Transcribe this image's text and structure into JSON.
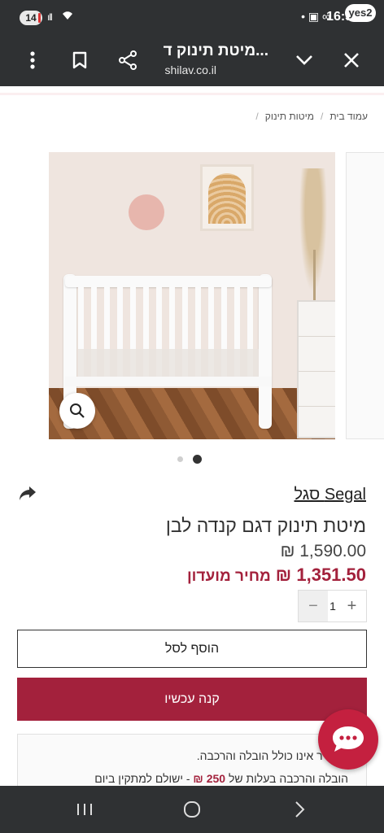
{
  "status_bar": {
    "notification_count": "14",
    "time": "16:35",
    "carrier_badge": "yes2",
    "signal": "ıll",
    "right_icons": "• ▣ ∞"
  },
  "toolbar": {
    "title": "מיטת תינוק ד...",
    "url": "shilav.co.il"
  },
  "breadcrumb": [
    {
      "label": "עמוד בית"
    },
    {
      "label": "מיטות תינוק"
    }
  ],
  "breadcrumb_sep": "/",
  "gallery": {
    "slide_count": 2,
    "active_index": 1
  },
  "product": {
    "brand": "Segal סגל",
    "title": "מיטת תינוק דגם קנדה לבן",
    "price": "1,590.00 ₪",
    "club_price": "1,351.50 ₪",
    "club_label": "מחיר מועדון",
    "quantity": "1",
    "minus": "−",
    "plus": "+"
  },
  "actions": {
    "add_to_cart": "הוסף לסל",
    "buy_now": "קנה עכשיו"
  },
  "info": {
    "line1": "המחיר אינו כולל הובלה והרכבה.",
    "line2_prefix": "הובלה והרכבה בעלות של",
    "line2_amount": "250 ₪",
    "line2_suffix": "- ישולם למתקין ביום"
  },
  "colors": {
    "accent": "#a3213c",
    "chrome": "#2f3133"
  }
}
